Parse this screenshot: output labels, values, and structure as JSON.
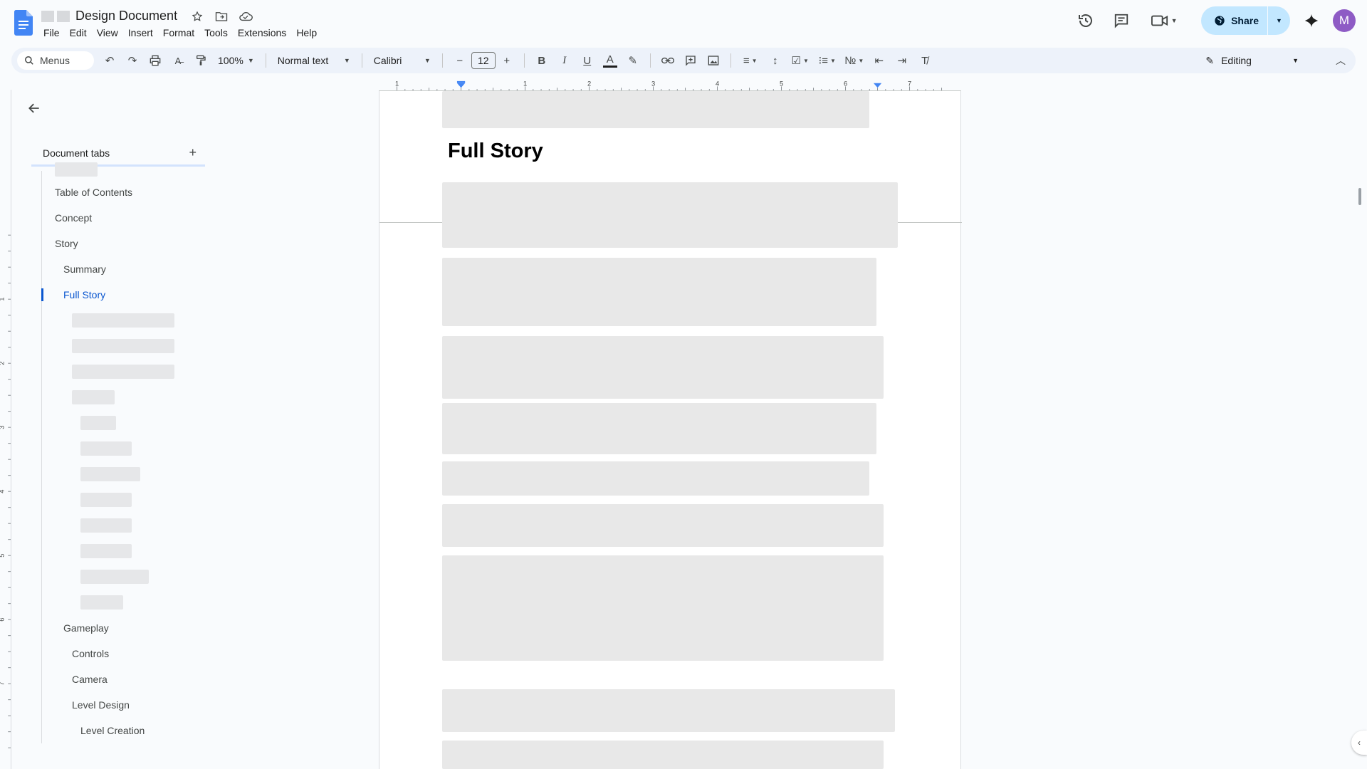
{
  "doc": {
    "title": "Design Document",
    "menus": [
      "File",
      "Edit",
      "View",
      "Insert",
      "Format",
      "Tools",
      "Extensions",
      "Help"
    ]
  },
  "header": {
    "share_label": "Share",
    "avatar_initial": "M"
  },
  "toolbar": {
    "search_label": "Menus",
    "zoom": "100%",
    "style": "Normal text",
    "font": "Calibri",
    "font_size": "12",
    "mode": "Editing"
  },
  "ruler": {
    "marks": [
      "1",
      "1",
      "2",
      "3",
      "4",
      "5",
      "6",
      "7"
    ],
    "v_marks": [
      "1",
      "2",
      "3",
      "4",
      "5",
      "6",
      "7"
    ]
  },
  "sidebar": {
    "header": "Document tabs",
    "items": [
      {
        "label": "Table of Contents",
        "level": 0
      },
      {
        "label": "Concept",
        "level": 0
      },
      {
        "label": "Story",
        "level": 0
      },
      {
        "label": "Summary",
        "level": 1
      },
      {
        "label": "Full Story",
        "level": 1,
        "active": true
      },
      {
        "label": "Gameplay",
        "level": 1
      },
      {
        "label": "Controls",
        "level": 2
      },
      {
        "label": "Camera",
        "level": 2
      },
      {
        "label": "Level Design",
        "level": 2
      },
      {
        "label": "Level Creation",
        "level": 3
      }
    ]
  },
  "page": {
    "heading": "Full Story"
  },
  "colors": {
    "accent": "#0b57d0",
    "share_bg": "#c2e7ff",
    "avatar": "#8e5bc5"
  }
}
